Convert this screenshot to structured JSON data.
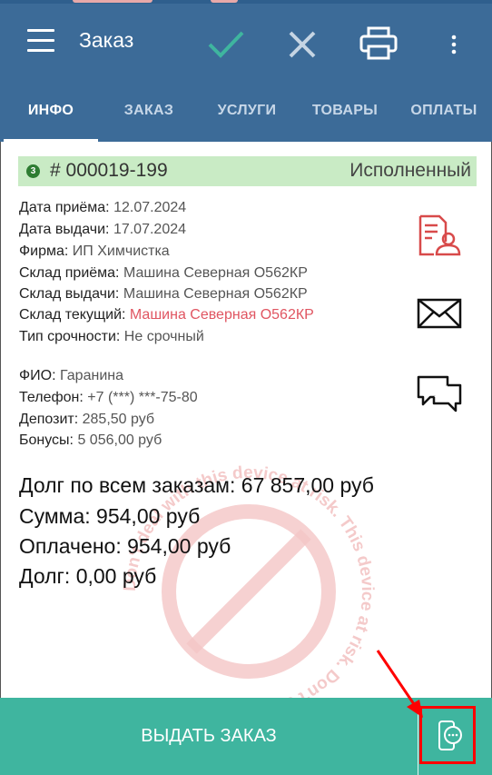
{
  "appbar": {
    "title": "Заказ",
    "icons": [
      "menu-icon",
      "check-icon",
      "close-icon",
      "print-icon",
      "more-vertical-icon"
    ],
    "accent_color": "#3c6b98",
    "check_color": "#3fb59f"
  },
  "tabs": [
    {
      "label": "ИНФО",
      "active": true
    },
    {
      "label": "ЗАКАЗ",
      "active": false
    },
    {
      "label": "УСЛУГИ",
      "active": false
    },
    {
      "label": "ТОВАРЫ",
      "active": false
    },
    {
      "label": "ОПЛАТЫ",
      "active": false
    }
  ],
  "order": {
    "badge": "3",
    "number": "# 000019-199",
    "status": "Исполненный",
    "status_color": "#c9ebc5"
  },
  "details": [
    {
      "label": "Дата приёма:",
      "value": "12.07.2024"
    },
    {
      "label": "Дата выдачи:",
      "value": "17.07.2024"
    },
    {
      "label": "Фирма:",
      "value": "ИП Химчистка"
    },
    {
      "label": "Склад приёма:",
      "value": "Машина Северная О562КР"
    },
    {
      "label": "Склад выдачи:",
      "value": "Машина Северная О562КР"
    },
    {
      "label": "Склад текущий:",
      "value": "Машина Северная О562КР",
      "highlight": "#e05561"
    },
    {
      "label": "Тип срочности:",
      "value": "Не срочный"
    }
  ],
  "client": [
    {
      "label": "ФИО:",
      "value": "Гаранина"
    },
    {
      "label": "Телефон:",
      "value": "+7 (***) ***-75-80"
    },
    {
      "label": "Депозит:",
      "value": "285,50 руб"
    },
    {
      "label": "Бонусы:",
      "value": "5 056,00 руб"
    }
  ],
  "totals": {
    "debt_all": "Долг по всем заказам: 67 857,00 руб",
    "sum": "Сумма: 954,00 руб",
    "paid": "Оплачено: 954,00 руб",
    "debt": "Долг: 0,00 руб"
  },
  "side_icons": [
    "client-card-icon",
    "envelope-icon",
    "chat-icon"
  ],
  "watermark": {
    "text": "Don't deal with this device at risk. This device at risk. Don't deal I"
  },
  "bottom": {
    "issue_label": "ВЫДАТЬ ЗАКАЗ",
    "bar_color": "#3fb59f",
    "chat_icon": "phone-chat-icon"
  }
}
